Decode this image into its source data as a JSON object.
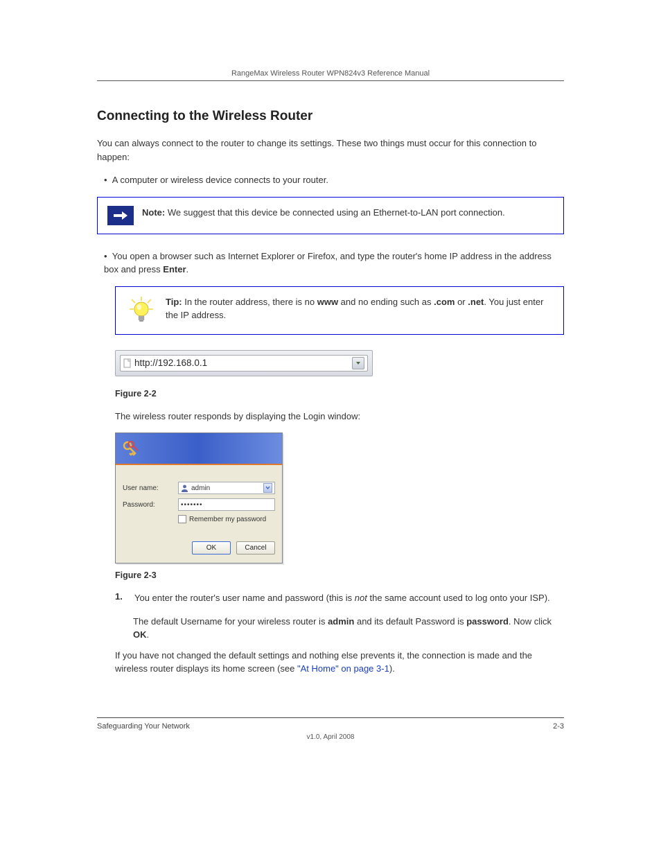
{
  "header_running": "RangeMax Wireless Router WPN824v3 Reference Manual",
  "section_title": "Connecting to the Wireless Router",
  "intro_paragraph": "You can always connect to the router to change its settings. These two things must occur for this connection to happen:",
  "bullet1": "A computer or wireless device connects to your router.",
  "note_box": {
    "label": "Note:",
    "text": "We suggest that this device be connected using an Ethernet-to-LAN port connection."
  },
  "bullet2_prefix": "You open a browser such as Internet Explorer or Firefox, and type the router's home IP address in the address box and press ",
  "bullet2_bold": "Enter",
  "bullet2_suffix": ".",
  "tip_box": {
    "label": "Tip:",
    "text": "In the router address, there is no ",
    "bold1": "www",
    "text2": " and no ending such as ",
    "bold2": ".com",
    "text3": " or ",
    "bold3": ".net",
    "text4": ". You just enter the IP address."
  },
  "url_display": "http://192.168.0.1",
  "figure1_caption": "Figure 2-2",
  "line_after_fig1": "The wireless router responds by displaying the Login window:",
  "login_dialog": {
    "username_label": "User name:",
    "username_value": "admin",
    "password_label": "Password:",
    "password_value": "•••••••",
    "remember_label": "Remember my password",
    "ok_label": "OK",
    "cancel_label": "Cancel"
  },
  "figure2_caption": "Figure 2-3",
  "step1_num": "1.",
  "step1_prefix": "You enter the router's user name and password (this is ",
  "step1_italic": "not",
  "step1_suffix": " the same account used to log onto your ISP).",
  "step1a_prefix": "The default Username for your wireless router is ",
  "step1a_bold1": "admin",
  "step1a_mid": " and its default Password is ",
  "step1a_bold2": "password",
  "step1a_mid2": ". Now click ",
  "step1a_bold3": "OK",
  "step1a_suffix": ".",
  "post_paragraph_prefix": "If you have not changed the default settings and nothing else prevents it, the connection is made and the wireless router displays its home screen (see ",
  "post_paragraph_link": "\"At Home\" on page 3-1",
  "post_paragraph_suffix": ").",
  "footer_left": "Safeguarding Your Network",
  "footer_right": "2-3",
  "footer_version": "v1.0, April 2008"
}
